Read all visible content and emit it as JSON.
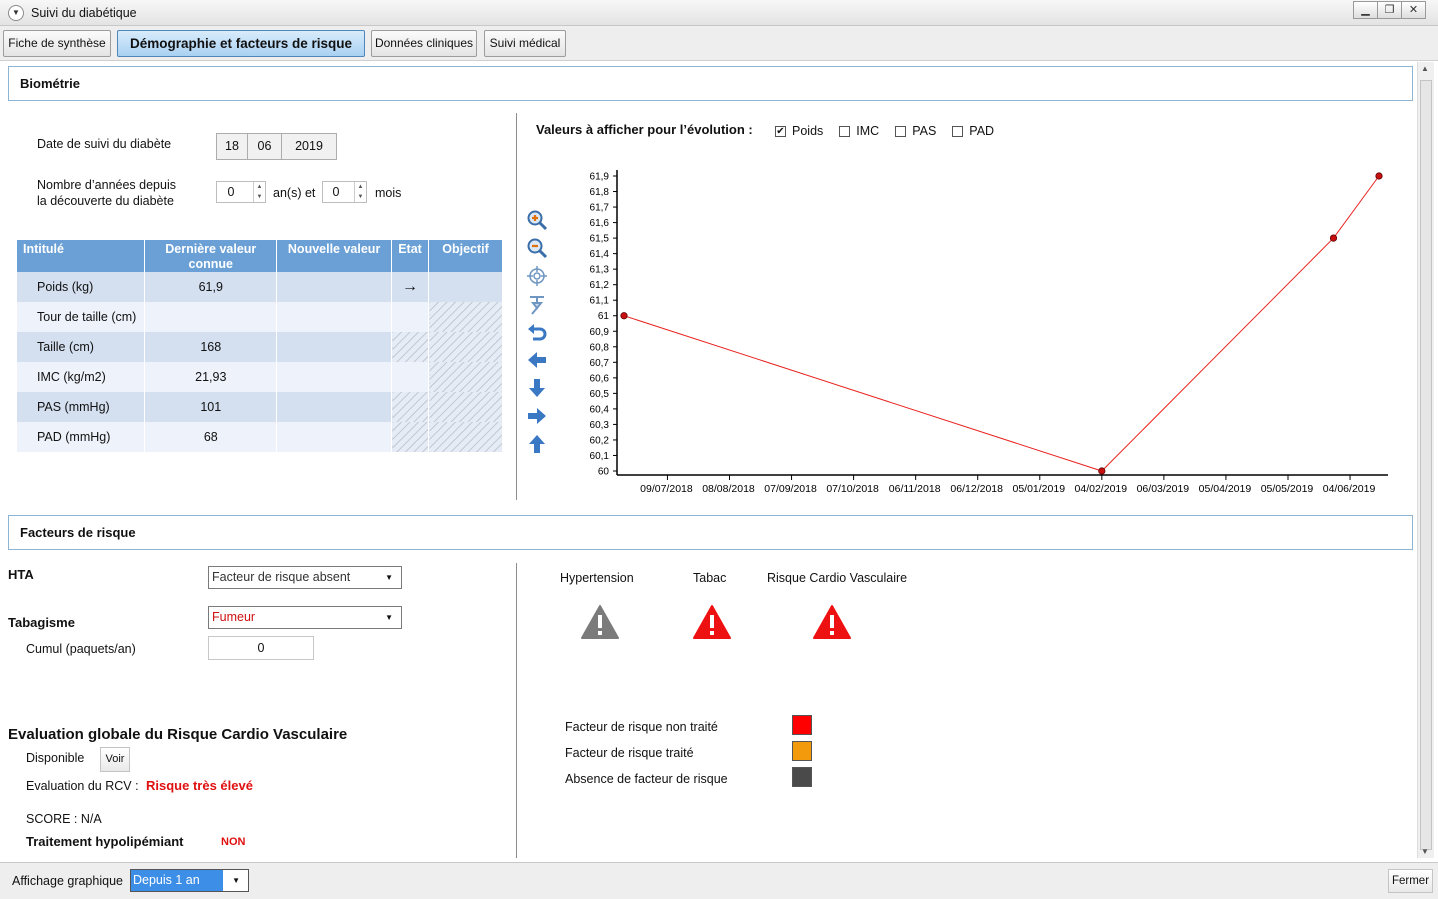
{
  "window": {
    "title": "Suivi du diabétique"
  },
  "tabs": [
    {
      "label": "Fiche de synthèse"
    },
    {
      "label": "Démographie et facteurs de risque"
    },
    {
      "label": "Données cliniques"
    },
    {
      "label": "Suivi médical"
    }
  ],
  "biometrie": {
    "section_title": "Biométrie",
    "date_label": "Date de suivi du diabète",
    "date": {
      "day": "18",
      "month": "06",
      "year": "2019"
    },
    "years_label_line1": "Nombre d’années depuis",
    "years_label_line2": "la découverte du diabète",
    "years_value": "0",
    "years_unit": "an(s) et",
    "months_value": "0",
    "months_unit": "mois",
    "table": {
      "headers": [
        "Intitulé",
        "Dernière valeur connue",
        "Nouvelle valeur",
        "Etat",
        "Objectif"
      ],
      "rows": [
        {
          "label": "Poids (kg)",
          "last": "61,9",
          "new": "",
          "etat": "→",
          "objectif": ""
        },
        {
          "label": "Tour de taille (cm)",
          "last": "",
          "new": "",
          "etat": "",
          "objectif": ""
        },
        {
          "label": "Taille (cm)",
          "last": "168",
          "new": "",
          "etat": "",
          "objectif": ""
        },
        {
          "label": "IMC (kg/m2)",
          "last": "21,93",
          "new": "",
          "etat": "",
          "objectif": ""
        },
        {
          "label": "PAS (mmHg)",
          "last": "101",
          "new": "",
          "etat": "",
          "objectif": ""
        },
        {
          "label": "PAD (mmHg)",
          "last": "68",
          "new": "",
          "etat": "",
          "objectif": ""
        }
      ]
    },
    "evolution_label": "Valeurs à afficher pour l’évolution :",
    "evolution_options": [
      {
        "label": "Poids",
        "checked": true
      },
      {
        "label": "IMC",
        "checked": false
      },
      {
        "label": "PAS",
        "checked": false
      },
      {
        "label": "PAD",
        "checked": false
      }
    ],
    "chart_tools": [
      "zoom-in-icon",
      "zoom-out-icon",
      "target-icon",
      "pin-icon",
      "undo-icon",
      "arrow-left-icon",
      "arrow-down-icon",
      "arrow-right-icon",
      "arrow-up-icon"
    ]
  },
  "chart_data": {
    "type": "line",
    "x": [
      "18/06/2018",
      "04/02/2019",
      "27/05/2019",
      "18/06/2019"
    ],
    "y": [
      61.0,
      60.0,
      61.5,
      61.9
    ],
    "x_ticks": [
      "09/07/2018",
      "08/08/2018",
      "07/09/2018",
      "07/10/2018",
      "06/11/2018",
      "06/12/2018",
      "05/01/2019",
      "04/02/2019",
      "06/03/2019",
      "05/04/2019",
      "05/05/2019",
      "04/06/2019"
    ],
    "y_ticks": [
      "61,9",
      "61,8",
      "61,7",
      "61,6",
      "61,5",
      "61,4",
      "61,3",
      "61,2",
      "61,1",
      "61",
      "60,9",
      "60,8",
      "60,7",
      "60,6",
      "60,5",
      "60,4",
      "60,3",
      "60,2",
      "60,1",
      "60"
    ],
    "ylim": [
      60,
      61.9
    ],
    "line_color": "#e8231f",
    "grid": false
  },
  "facteurs": {
    "section_title": "Facteurs de risque",
    "hta_label": "HTA",
    "hta_value": "Facteur de risque absent",
    "tabac_label": "Tabagisme",
    "tabac_value": "Fumeur",
    "cumul_label": "Cumul (paquets/an)",
    "cumul_value": "0",
    "indicators": [
      {
        "label": "Hypertension",
        "color": "#7a7a7a"
      },
      {
        "label": "Tabac",
        "color": "#ee1111"
      },
      {
        "label": "Risque Cardio Vasculaire",
        "color": "#ee1111"
      }
    ],
    "legend": [
      {
        "label": "Facteur de risque non traité",
        "color": "#ff0000"
      },
      {
        "label": "Facteur de risque traité",
        "color": "#f29a0c"
      },
      {
        "label": "Absence de facteur de risque",
        "color": "#4a4a4a"
      }
    ]
  },
  "rcv": {
    "title": "Evaluation globale du Risque Cardio Vasculaire",
    "disponible_label": "Disponible",
    "voir_label": "Voir",
    "eval_label": "Evaluation du RCV :",
    "eval_value": "Risque très élevé",
    "score_label": "SCORE : N/A",
    "traitement_label": "Traitement hypolipémiant",
    "traitement_value": "NON"
  },
  "footer": {
    "affichage_label": "Affichage graphique",
    "affichage_value": "Depuis 1 an",
    "close_label": "Fermer"
  }
}
